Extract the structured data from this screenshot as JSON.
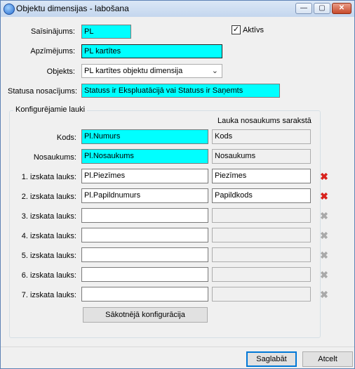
{
  "window": {
    "title": "Objektu dimensijas - labošana",
    "buttons": {
      "minimize": "—",
      "maximize": "▢",
      "close": "✕"
    }
  },
  "form": {
    "saisinajums_label": "Saīsinājums:",
    "saisinajums_value": "PL",
    "aktivs_label": "Aktīvs",
    "aktivs_checked": true,
    "apzimejums_label": "Apzīmējums:",
    "apzimejums_value": "PL kartītes",
    "objekts_label": "Objekts:",
    "objekts_value": "PL kartītes objektu dimensija",
    "statusa_label": "Statusa nosacījums:",
    "statusa_value": "Statuss ir Ekspluatācijā vai Statuss ir Saņemts"
  },
  "group": {
    "title": "Konfigurējamie lauki",
    "column_header": "Lauka nosaukums sarakstā",
    "rows": [
      {
        "label": "Kods:",
        "value": "Pl.Numurs",
        "name": "Kods"
      },
      {
        "label": "Nosaukums:",
        "value": "Pl.Nosaukums",
        "name": "Nosaukums"
      },
      {
        "label": "1. izskata lauks:",
        "value": "Pl.Piezīmes",
        "name": "Piezīmes"
      },
      {
        "label": "2. izskata lauks:",
        "value": "Pl.Papildnumurs",
        "name": "Papildkods"
      },
      {
        "label": "3. izskata lauks:",
        "value": "",
        "name": ""
      },
      {
        "label": "4. izskata lauks:",
        "value": "",
        "name": ""
      },
      {
        "label": "5. izskata lauks:",
        "value": "",
        "name": ""
      },
      {
        "label": "6. izskata lauks:",
        "value": "",
        "name": ""
      },
      {
        "label": "7. izskata lauks:",
        "value": "",
        "name": ""
      }
    ],
    "reset_button": "Sākotnējā konfigurācija"
  },
  "footer": {
    "save": "Saglabāt",
    "cancel": "Atcelt"
  },
  "icons": {
    "delete_active": "delete-x-red",
    "delete_inactive": "delete-x-gray",
    "accent": "#00ffff",
    "delete_color": "#d8221c"
  }
}
